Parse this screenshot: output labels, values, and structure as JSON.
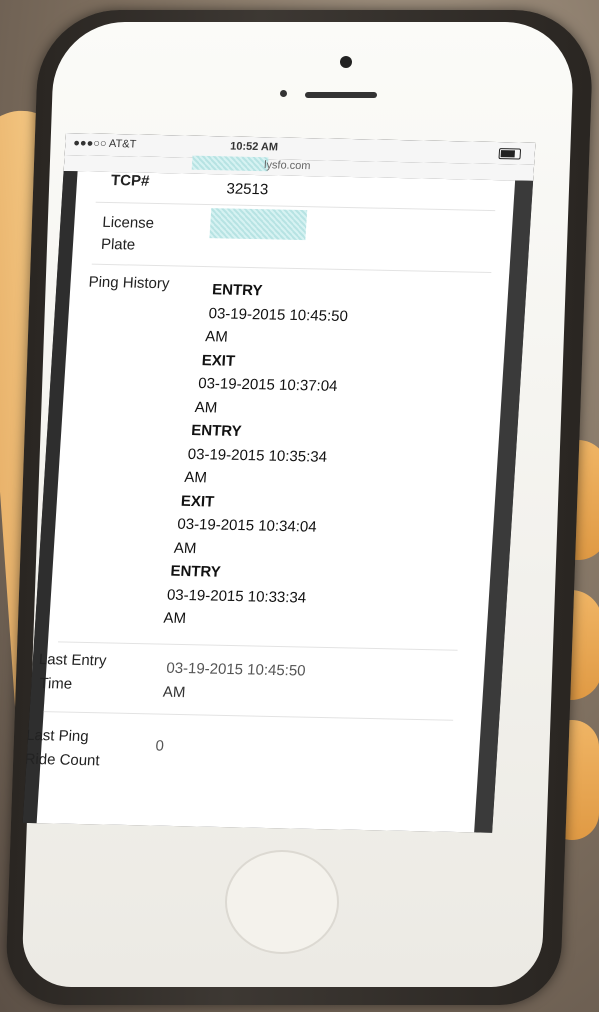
{
  "status_bar": {
    "carrier": "●●●○○ AT&T",
    "wifi_icon": "wifi-icon",
    "time": "10:52 AM",
    "battery_icon": "battery-icon"
  },
  "url_bar": {
    "url": "lysfo.com"
  },
  "details": {
    "tcp_label": "TCP#",
    "tcp_value": "32513",
    "license_label_line1": "License",
    "license_label_line2": "Plate",
    "ping_history_label": "Ping History",
    "ping_history": [
      {
        "type": "ENTRY",
        "date": "03-19-2015 10:45:50",
        "ampm": "AM"
      },
      {
        "type": "EXIT",
        "date": "03-19-2015 10:37:04",
        "ampm": "AM"
      },
      {
        "type": "ENTRY",
        "date": "03-19-2015 10:35:34",
        "ampm": "AM"
      },
      {
        "type": "EXIT",
        "date": "03-19-2015 10:34:04",
        "ampm": "AM"
      },
      {
        "type": "ENTRY",
        "date": "03-19-2015 10:33:34",
        "ampm": "AM"
      }
    ],
    "last_entry_label_line1": "Last Entry",
    "last_entry_label_line2": "Time",
    "last_entry_value_line1": "03-19-2015 10:45:50",
    "last_entry_value_line2": "AM",
    "last_ping_label_line1": "Last Ping",
    "last_ping_label_line2": "Ride Count",
    "last_ping_value": "0"
  }
}
